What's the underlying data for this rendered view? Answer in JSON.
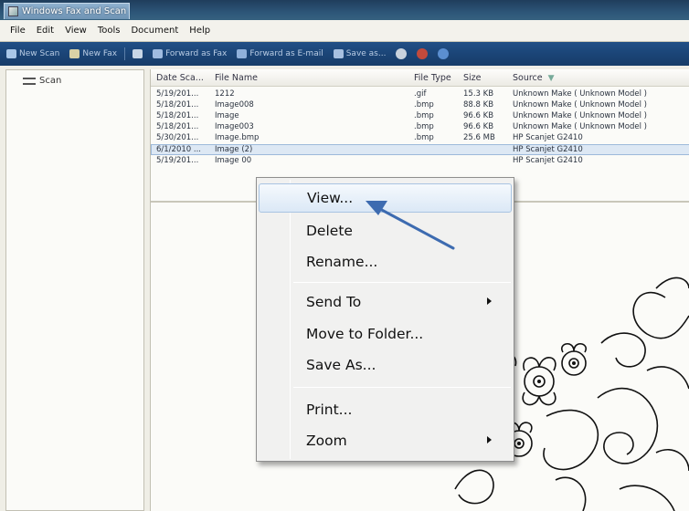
{
  "window": {
    "title": "Windows Fax and Scan"
  },
  "menubar": {
    "items": [
      "File",
      "Edit",
      "View",
      "Tools",
      "Document",
      "Help"
    ]
  },
  "toolbar": {
    "new_scan": "New Scan",
    "new_fax": "New Fax",
    "forward_as_fax": "Forward as Fax",
    "forward_as_email": "Forward as E-mail",
    "save_as": "Save as..."
  },
  "sidebar": {
    "items": [
      {
        "label": "Scan",
        "icon": "scanner-icon"
      }
    ]
  },
  "file_list": {
    "columns": [
      "Date Sca...",
      "File Name",
      "File Type",
      "Size",
      "Source"
    ],
    "rows": [
      {
        "date": "5/19/201...",
        "name": "1212",
        "type": ".gif",
        "size": "15.3 KB",
        "source": "Unknown Make ( Unknown Model )"
      },
      {
        "date": "5/18/201...",
        "name": "Image008",
        "type": ".bmp",
        "size": "88.8 KB",
        "source": "Unknown Make ( Unknown Model )"
      },
      {
        "date": "5/18/201...",
        "name": "Image",
        "type": ".bmp",
        "size": "96.6 KB",
        "source": "Unknown Make ( Unknown Model )"
      },
      {
        "date": "5/18/201...",
        "name": "Image003",
        "type": ".bmp",
        "size": "96.6 KB",
        "source": "Unknown Make ( Unknown Model )"
      },
      {
        "date": "5/30/201...",
        "name": "Image.bmp",
        "type": ".bmp",
        "size": "25.6 MB",
        "source": "HP Scanjet G2410"
      },
      {
        "date": "6/1/2010 ...",
        "name": "Image (2)",
        "type": "",
        "size": "",
        "source": "HP Scanjet G2410",
        "selected": true
      },
      {
        "date": "5/19/201...",
        "name": "Image 00",
        "type": "",
        "size": "",
        "source": "HP Scanjet G2410"
      }
    ]
  },
  "context_menu": {
    "items": [
      "View...",
      "Delete",
      "Rename...",
      "Send To",
      "Move to Folder...",
      "Save As...",
      "Print...",
      "Zoom"
    ],
    "highlighted": "View..."
  },
  "colors": {
    "toolbar": "#1b4577",
    "titlebar": "#2d5578",
    "highlight": "#dbe8f6",
    "arrow": "#3d6bb0"
  }
}
